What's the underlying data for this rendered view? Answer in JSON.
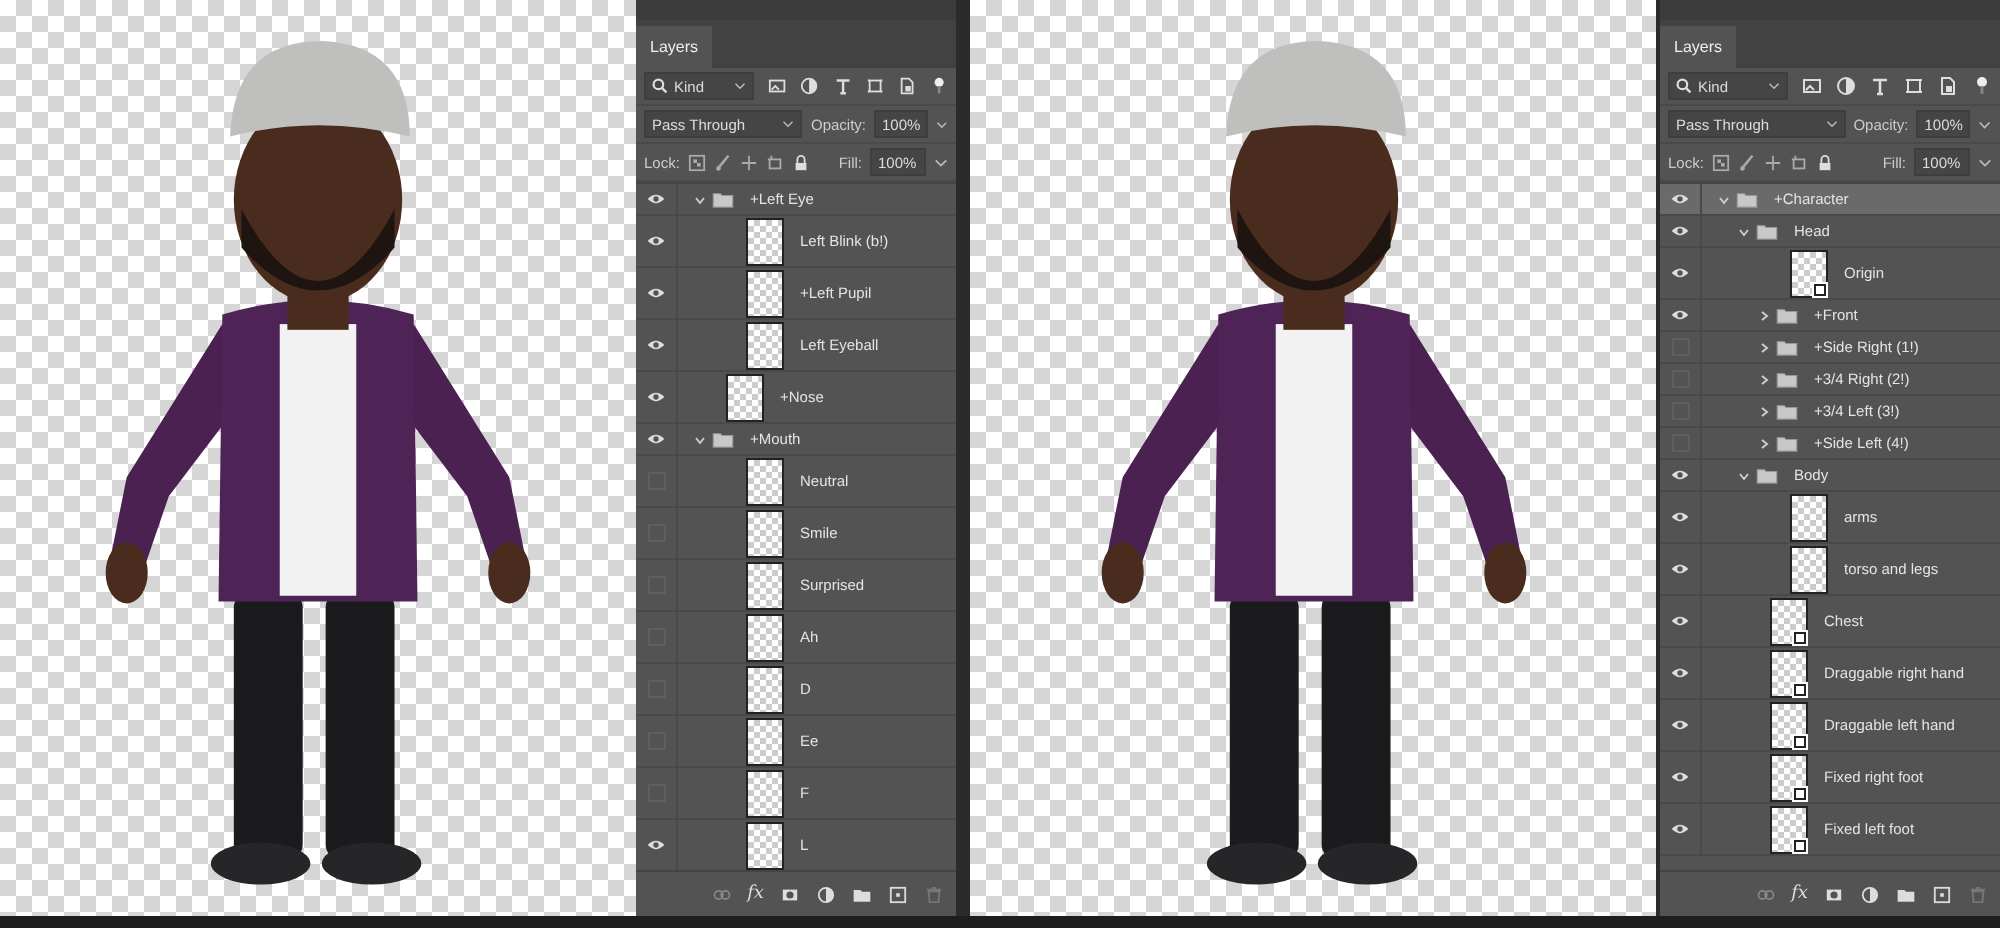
{
  "documents": [
    {
      "panel": {
        "tab": "Layers",
        "filter": "Kind",
        "blend_mode": "Pass Through",
        "opacity_label": "Opacity:",
        "opacity": "100%",
        "lock_label": "Lock:",
        "fill_label": "Fill:",
        "fill": "100%",
        "footer_fx": "fx",
        "layers": [
          {
            "name": "+Left Eye",
            "kind": "group",
            "visible": true,
            "selected": false,
            "expanded": true,
            "children": [
              {
                "name": "Left Blink (b!)",
                "kind": "layer",
                "visible": true,
                "selected": false
              },
              {
                "name": "+Left Pupil",
                "kind": "layer",
                "visible": true,
                "selected": false
              },
              {
                "name": "Left Eyeball",
                "kind": "layer",
                "visible": true,
                "selected": false
              }
            ]
          },
          {
            "name": "+Nose",
            "kind": "layer",
            "visible": true,
            "selected": false
          },
          {
            "name": "+Mouth",
            "kind": "group",
            "visible": true,
            "selected": false,
            "expanded": true,
            "children": [
              {
                "name": "Neutral",
                "kind": "layer",
                "visible": false,
                "selected": false
              },
              {
                "name": "Smile",
                "kind": "layer",
                "visible": false,
                "selected": false
              },
              {
                "name": "Surprised",
                "kind": "layer",
                "visible": false,
                "selected": false
              },
              {
                "name": "Ah",
                "kind": "layer",
                "visible": false,
                "selected": false
              },
              {
                "name": "D",
                "kind": "layer",
                "visible": false,
                "selected": false
              },
              {
                "name": "Ee",
                "kind": "layer",
                "visible": false,
                "selected": false
              },
              {
                "name": "F",
                "kind": "layer",
                "visible": false,
                "selected": false
              },
              {
                "name": "L",
                "kind": "layer",
                "visible": true,
                "selected": false
              }
            ]
          }
        ]
      }
    },
    {
      "panel": {
        "tab": "Layers",
        "filter": "Kind",
        "blend_mode": "Pass Through",
        "opacity_label": "Opacity:",
        "opacity": "100%",
        "lock_label": "Lock:",
        "fill_label": "Fill:",
        "fill": "100%",
        "footer_fx": "fx",
        "layers": [
          {
            "name": "+Character",
            "kind": "group",
            "visible": true,
            "selected": true,
            "expanded": true,
            "children": [
              {
                "name": "Head",
                "kind": "group",
                "visible": true,
                "selected": false,
                "expanded": true,
                "children": [
                  {
                    "name": "Origin",
                    "kind": "smart",
                    "visible": true,
                    "selected": false
                  },
                  {
                    "name": "+Front",
                    "kind": "group",
                    "visible": true,
                    "selected": false,
                    "expanded": false
                  },
                  {
                    "name": "+Side Right (1!)",
                    "kind": "group",
                    "visible": false,
                    "selected": false,
                    "expanded": false
                  },
                  {
                    "name": "+3/4 Right (2!)",
                    "kind": "group",
                    "visible": false,
                    "selected": false,
                    "expanded": false
                  },
                  {
                    "name": "+3/4 Left (3!)",
                    "kind": "group",
                    "visible": false,
                    "selected": false,
                    "expanded": false
                  },
                  {
                    "name": "+Side Left (4!)",
                    "kind": "group",
                    "visible": false,
                    "selected": false,
                    "expanded": false
                  }
                ]
              },
              {
                "name": "Body",
                "kind": "group",
                "visible": true,
                "selected": false,
                "expanded": true,
                "children": [
                  {
                    "name": "arms",
                    "kind": "layer",
                    "visible": true,
                    "selected": false
                  },
                  {
                    "name": "torso and legs",
                    "kind": "layer",
                    "visible": true,
                    "selected": false
                  }
                ]
              },
              {
                "name": "Chest",
                "kind": "smart",
                "visible": true,
                "selected": false
              },
              {
                "name": "Draggable right hand",
                "kind": "smart",
                "visible": true,
                "selected": false
              },
              {
                "name": "Draggable left hand",
                "kind": "smart",
                "visible": true,
                "selected": false
              },
              {
                "name": "Fixed right foot",
                "kind": "smart",
                "visible": true,
                "selected": false
              },
              {
                "name": "Fixed left foot",
                "kind": "smart",
                "visible": true,
                "selected": false
              }
            ]
          }
        ]
      }
    }
  ]
}
